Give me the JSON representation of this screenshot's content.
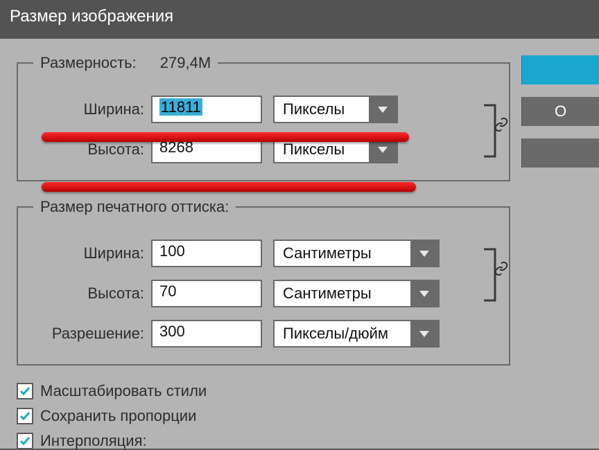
{
  "window": {
    "title": "Размер изображения"
  },
  "groups": {
    "pixelDimensions": {
      "legend_label": "Размерность:",
      "legend_value": "279,4M",
      "width_label": "Ширина:",
      "width_value": "11811",
      "width_unit": "Пикселы",
      "height_label": "Высота:",
      "height_value": "8268",
      "height_unit": "Пикселы",
      "link_icon": "chain-link-icon"
    },
    "printSize": {
      "legend": "Размер печатного оттиска:",
      "width_label": "Ширина:",
      "width_value": "100",
      "width_unit": "Сантиметры",
      "height_label": "Высота:",
      "height_value": "70",
      "height_unit": "Сантиметры",
      "res_label": "Разрешение:",
      "res_value": "300",
      "res_unit": "Пикселы/дюйм",
      "link_icon": "chain-link-icon"
    }
  },
  "checks": {
    "scale_styles": "Масштабировать стили",
    "constrain": "Сохранить пропорции",
    "interpolate": "Интерполяция:"
  },
  "buttons": {
    "ok": "",
    "cancel": "О",
    "auto": ""
  },
  "colors": {
    "accent": "#19a7cf",
    "red": "#e21b1b"
  }
}
